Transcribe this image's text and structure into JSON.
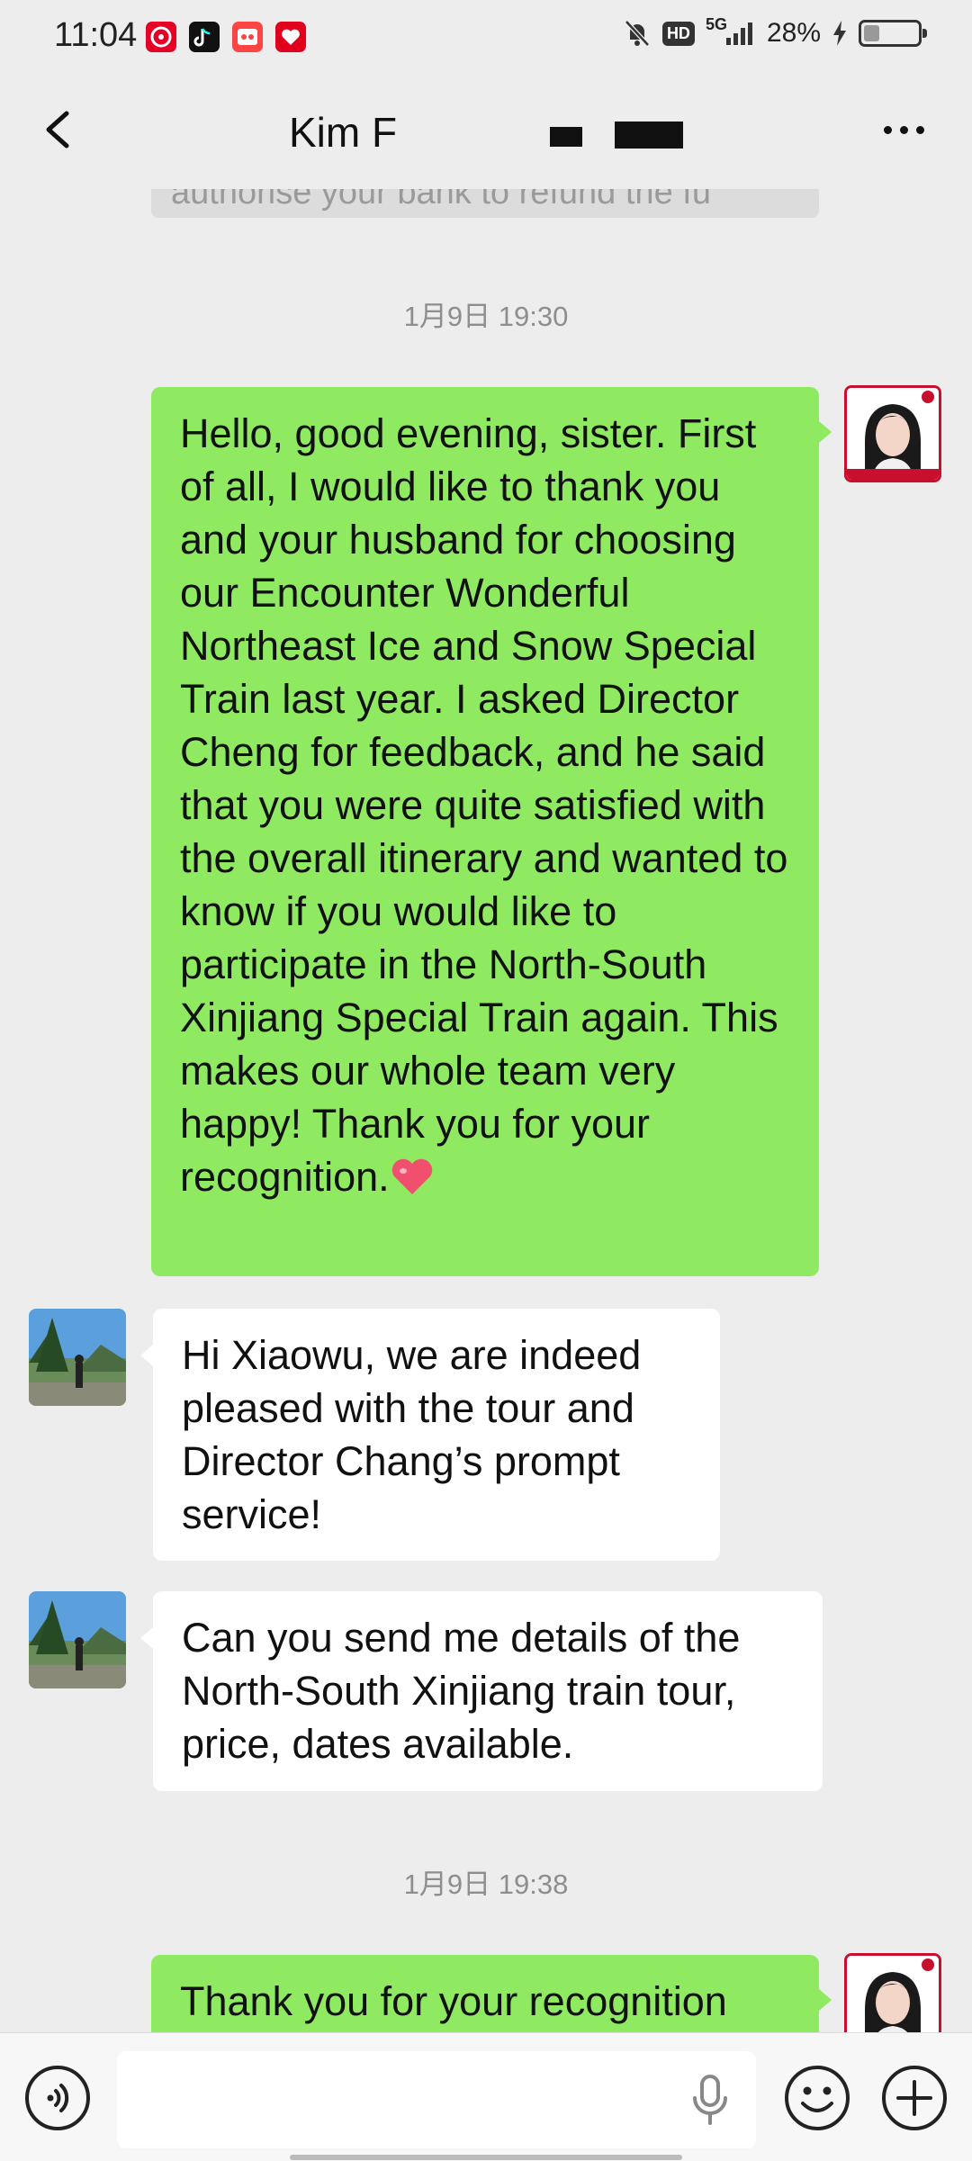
{
  "status_bar": {
    "time": "11:04",
    "network": "5G",
    "hd": "HD",
    "battery_percent": "28%",
    "battery_level": 0.28,
    "icons": [
      "netease-music-icon",
      "tiktok-icon",
      "app-icon",
      "app-icon-red",
      "mute-icon",
      "signal-icon",
      "charging-icon"
    ]
  },
  "header": {
    "title": "Kim F",
    "back_icon": "chevron-left-icon",
    "more_icon": "more-icon"
  },
  "chat": {
    "prev_message_fragment": "authorise your bank  to refund the fu",
    "timestamp_1": "1月9日 19:30",
    "msg_out_1": "Hello, good evening, sister. First of all, I would like to thank you and your husband for choosing our Encounter Wonderful Northeast Ice and Snow Special Train last year. I asked Director Cheng for feedback, and he said that you were quite satisfied with the overall itinerary and wanted to know if you would like to participate in the North-South Xinjiang Special Train again. This makes our whole team very happy! Thank you for your recognition.",
    "msg_in_1": "Hi Xiaowu, we are indeed pleased with the tour and Director Chang’s prompt service!",
    "msg_in_2": "Can you send me details of the North-South Xinjiang train tour, price, dates available.",
    "timestamp_2": "1月9日 19:38",
    "msg_out_2": "Thank you for your recognition"
  },
  "input_bar": {
    "voice_icon": "voice-icon",
    "mic_icon": "mic-icon",
    "emoji_icon": "emoji-icon",
    "plus_icon": "plus-icon"
  },
  "colors": {
    "background": "#ededed",
    "outgoing_bubble": "#8fea62",
    "incoming_bubble": "#ffffff",
    "accent_red": "#c8102e"
  }
}
